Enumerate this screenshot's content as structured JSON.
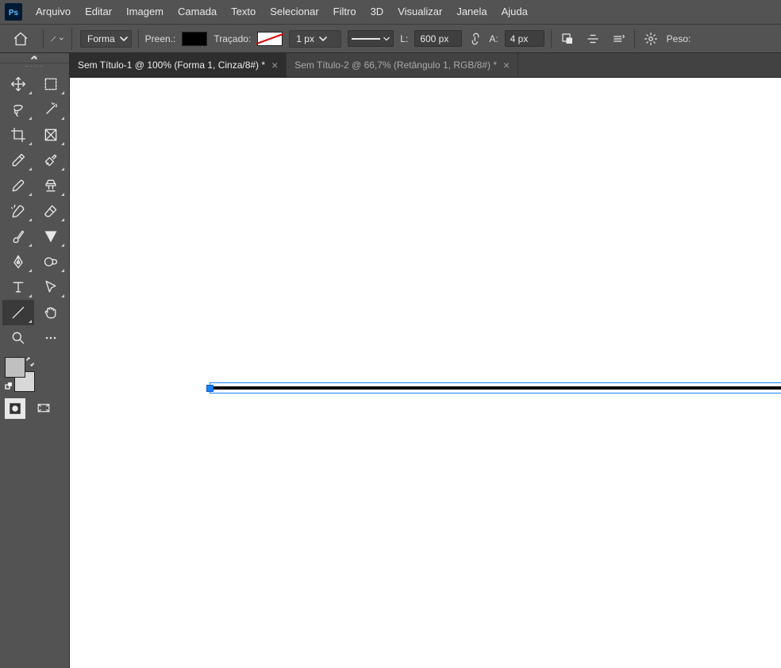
{
  "menubar": {
    "items": [
      "Arquivo",
      "Editar",
      "Imagem",
      "Camada",
      "Texto",
      "Selecionar",
      "Filtro",
      "3D",
      "Visualizar",
      "Janela",
      "Ajuda"
    ]
  },
  "optionsbar": {
    "mode_label": "Forma",
    "fill_label": "Preen.:",
    "stroke_label": "Traçado:",
    "stroke_width": "1 px",
    "width_label": "L:",
    "width_value": "600 px",
    "height_label": "A:",
    "height_value": "4 px",
    "weight_label": "Peso:"
  },
  "tabs": [
    {
      "label": "Sem Título-1 @ 100% (Forma 1, Cinza/8#) *",
      "active": true
    },
    {
      "label": "Sem Título-2 @ 66,7% (Retângulo 1, RGB/8#) *",
      "active": false
    }
  ],
  "tools": {
    "left": [
      "move",
      "lasso",
      "crop",
      "eyedropper",
      "spot-heal",
      "history-brush",
      "pen",
      "magnifying-glass",
      "text",
      "line",
      "zoom"
    ],
    "right": [
      "marquee",
      "magic-wand",
      "perspective-crop",
      "ruler",
      "clone-stamp",
      "eraser",
      "sharpen",
      "smudge",
      "path-select",
      "hand",
      "more"
    ]
  }
}
